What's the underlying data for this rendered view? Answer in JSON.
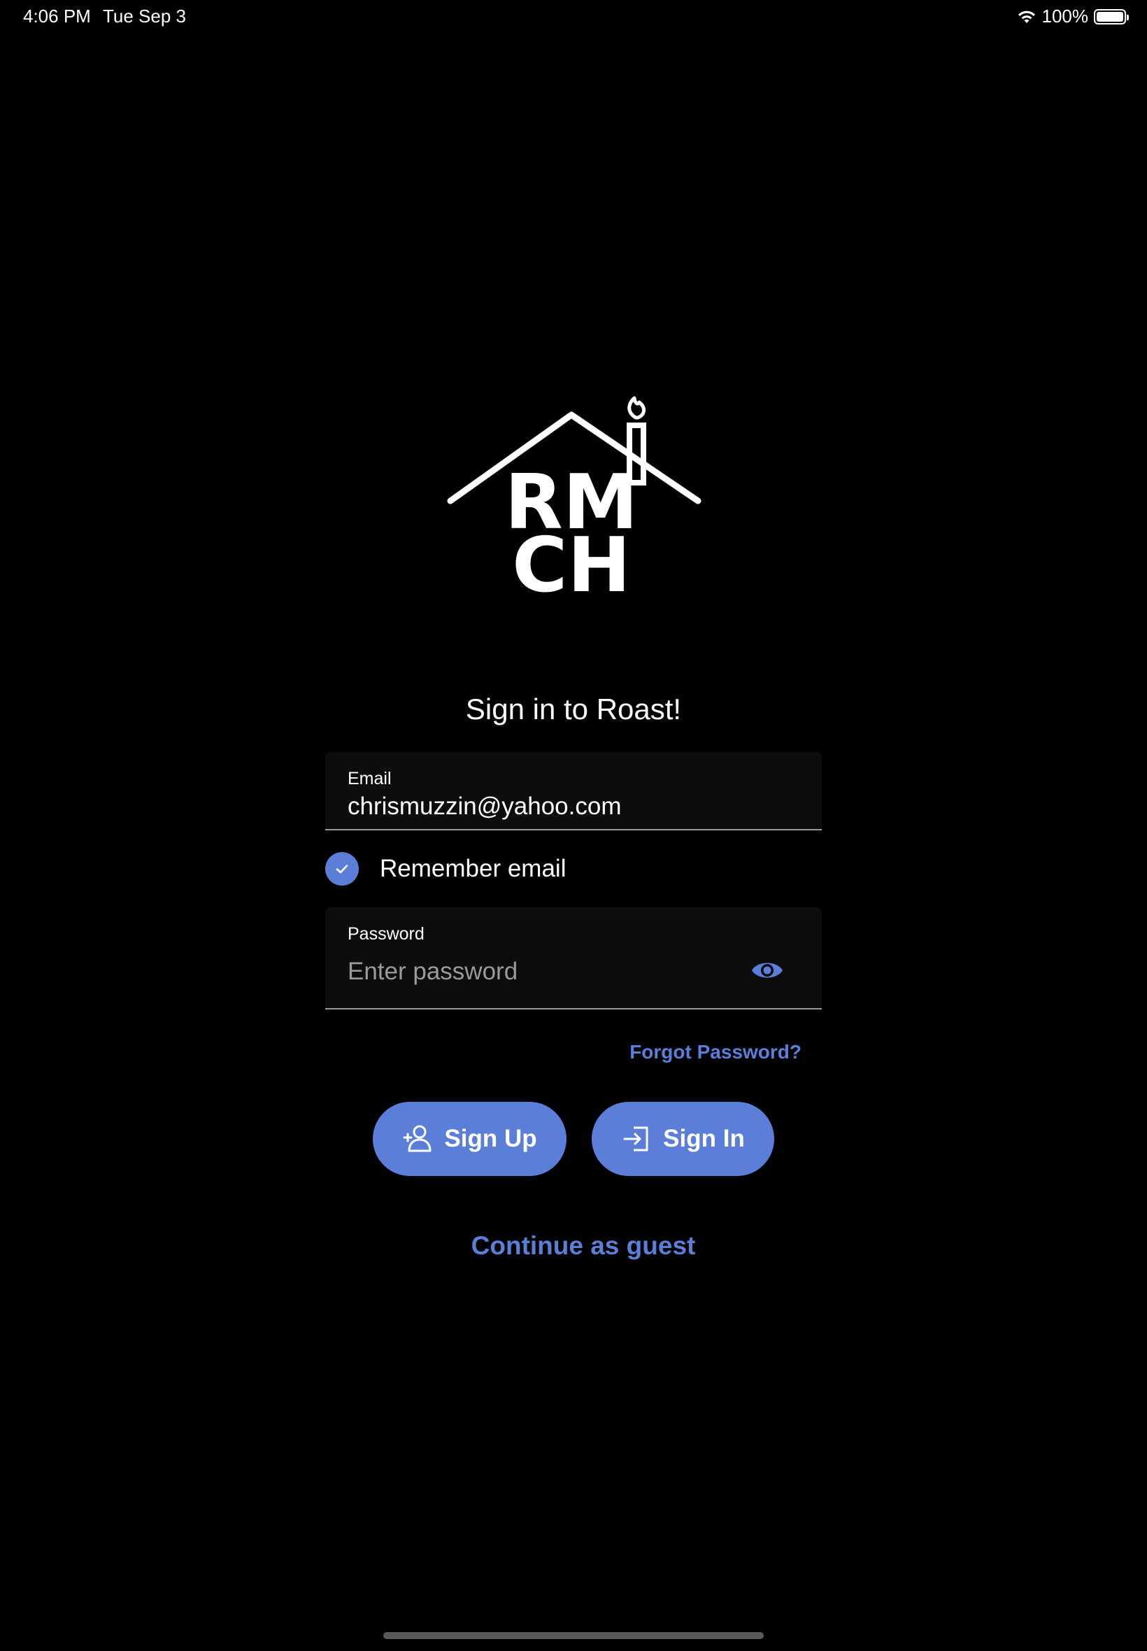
{
  "status_bar": {
    "time": "4:06 PM",
    "date": "Tue Sep 3",
    "battery": "100%"
  },
  "logo": {
    "line1": "RM",
    "line2": "CH"
  },
  "title": "Sign in to Roast!",
  "email": {
    "label": "Email",
    "value": "chrismuzzin@yahoo.com"
  },
  "remember": {
    "label": "Remember email",
    "checked": true
  },
  "password": {
    "label": "Password",
    "placeholder": "Enter password"
  },
  "forgot_label": "Forgot Password?",
  "buttons": {
    "sign_up": "Sign Up",
    "sign_in": "Sign In"
  },
  "guest_label": "Continue as guest",
  "colors": {
    "accent": "#5b7fd9",
    "background": "#000000",
    "field_bg": "#0d0d0d"
  }
}
